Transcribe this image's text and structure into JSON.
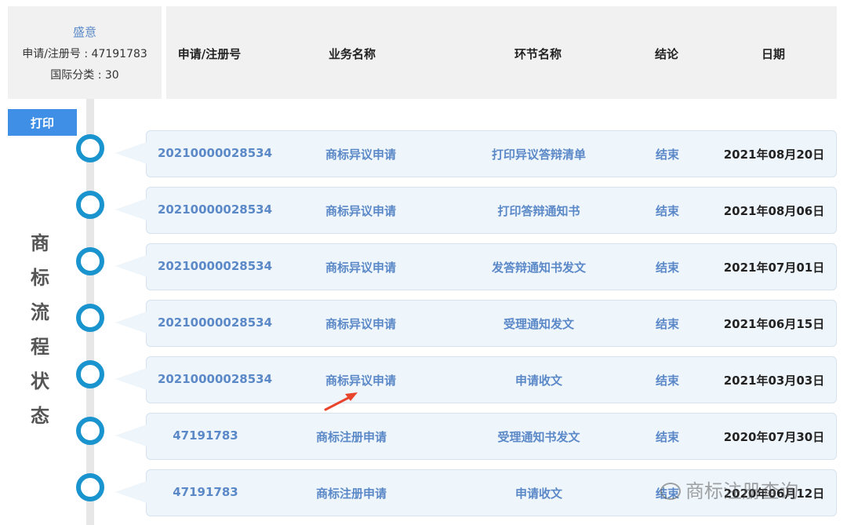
{
  "info": {
    "name": "盛意",
    "reg_no": "申请/注册号 : 47191783",
    "intl_class": "国际分类 : 30"
  },
  "columns": [
    "申请/注册号",
    "业务名称",
    "环节名称",
    "结论",
    "日期"
  ],
  "print_label": "打印",
  "side_title": [
    "商",
    "标",
    "流",
    "程",
    "状",
    "态"
  ],
  "rows": [
    {
      "number": "20210000028534",
      "business": "商标异议申请",
      "step": "打印异议答辩清单",
      "result": "结束",
      "date": "2021年08月20日"
    },
    {
      "number": "20210000028534",
      "business": "商标异议申请",
      "step": "打印答辩通知书",
      "result": "结束",
      "date": "2021年08月06日"
    },
    {
      "number": "20210000028534",
      "business": "商标异议申请",
      "step": "发答辩通知书发文",
      "result": "结束",
      "date": "2021年07月01日"
    },
    {
      "number": "20210000028534",
      "business": "商标异议申请",
      "step": "受理通知发文",
      "result": "结束",
      "date": "2021年06月15日"
    },
    {
      "number": "20210000028534",
      "business": "商标异议申请",
      "step": "申请收文",
      "result": "结束",
      "date": "2021年03月03日"
    },
    {
      "number": "47191783",
      "business": "商标注册申请",
      "step": "受理通知书发文",
      "result": "结束",
      "date": "2020年07月30日"
    },
    {
      "number": "47191783",
      "business": "商标注册申请",
      "step": "申请收文",
      "result": "结束",
      "date": "2020年06月12日"
    }
  ],
  "watermark": "商标注册查询",
  "colors": {
    "accent": "#5b89c8",
    "node": "#1a94cf",
    "button": "#3f8fe6",
    "arrow": "#e8452c"
  }
}
